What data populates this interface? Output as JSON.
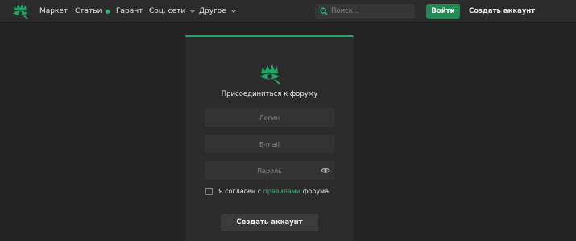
{
  "colors": {
    "accent": "#22a465",
    "page_bg": "#232323",
    "panel_bg": "#2b2b2b",
    "field_bg": "#333333",
    "link": "#2bbd72"
  },
  "header": {
    "logo_icon": "dragon-eye-logo-icon",
    "nav": [
      {
        "label": "Маркет"
      },
      {
        "label": "Статьи",
        "badge_icon": "green-dot-icon"
      },
      {
        "label": "Гарант"
      },
      {
        "label": "Соц. сети",
        "dropdown_icon": "chevron-down-icon"
      },
      {
        "label": "Другое",
        "dropdown_icon": "chevron-down-icon"
      }
    ],
    "search": {
      "placeholder": "Поиск...",
      "icon": "search-icon"
    },
    "login_label": "Войти",
    "create_account_label": "Создать аккаунт"
  },
  "form": {
    "logo_icon": "dragon-eye-logo-icon",
    "title": "Присоединиться к форуму",
    "login_placeholder": "Логин",
    "email_placeholder": "E-mail",
    "password_placeholder": "Пароль",
    "password_toggle_icon": "eye-icon",
    "agree_prefix": "Я согласен с ",
    "agree_link": "правилами",
    "agree_suffix": " форума.",
    "agree_checked": false,
    "submit_label": "Создать аккаунт"
  }
}
